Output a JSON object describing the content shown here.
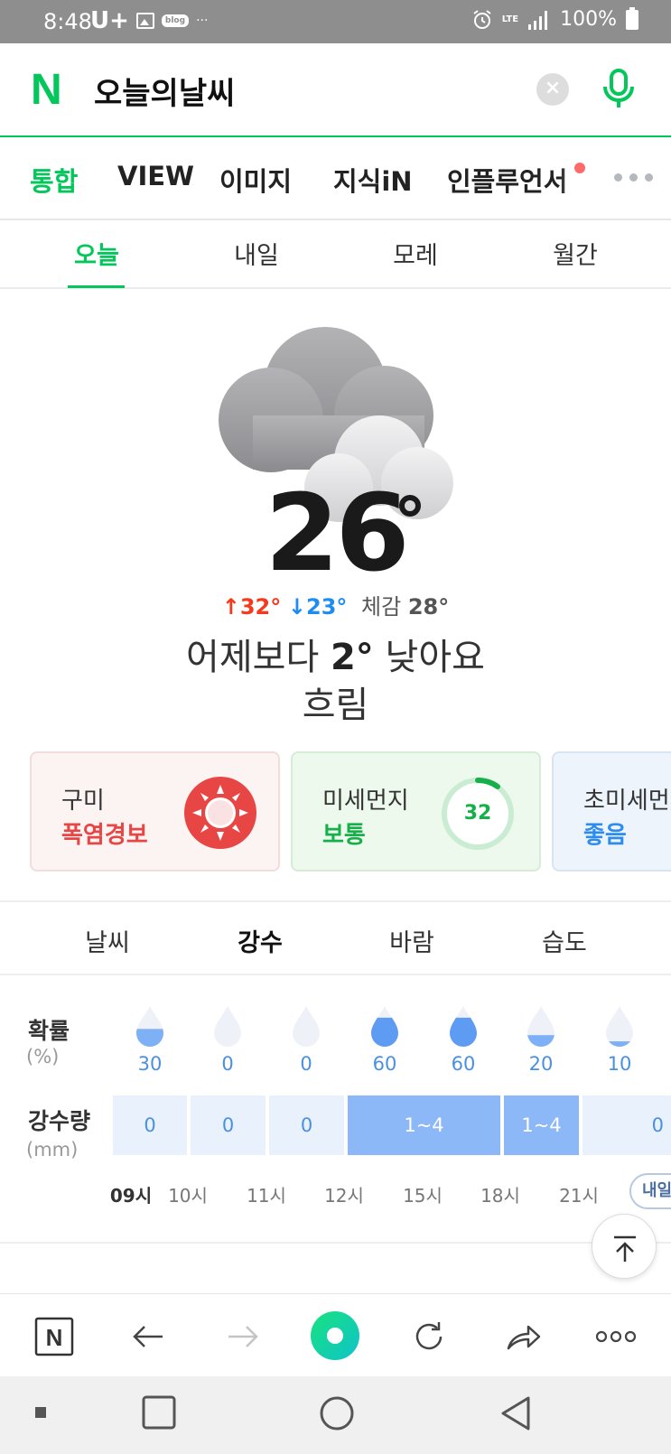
{
  "status_bar": {
    "time": "8:48",
    "carrier": "U+",
    "blog_badge": "blog",
    "overflow": "···",
    "lte": "LTE",
    "battery": "100%",
    "icons": [
      "image-icon",
      "blog-icon",
      "alarm-icon",
      "lte-icon",
      "signal-icon",
      "battery-icon"
    ]
  },
  "search": {
    "logo": "N",
    "query": "오늘의날씨",
    "clear_symbol": "×"
  },
  "category_tabs": [
    "통합",
    "VIEW",
    "이미지",
    "지식iN",
    "인플루언서"
  ],
  "day_tabs": [
    "오늘",
    "내일",
    "모레",
    "월간"
  ],
  "weather": {
    "temperature": "26",
    "high_arrow": "↑",
    "high": "32°",
    "low_arrow": "↓",
    "low": "23°",
    "feels_label": "체감",
    "feels": "28°",
    "compare_prefix": "어제보다",
    "compare_value": "2°",
    "compare_suffix": "낮아요",
    "condition": "흐림"
  },
  "cards": [
    {
      "title": "구미",
      "status": "폭염경보"
    },
    {
      "title": "미세먼지",
      "status": "보통",
      "value": "32"
    },
    {
      "title": "초미세먼",
      "status": "좋음"
    }
  ],
  "sub_tabs": [
    "날씨",
    "강수",
    "바람",
    "습도"
  ],
  "precip": {
    "prob_label": "확률",
    "prob_unit": "(%)",
    "amount_label": "강수량",
    "amount_unit": "(mm)",
    "probabilities": [
      "30",
      "0",
      "0",
      "60",
      "60",
      "20",
      "10"
    ],
    "amounts": [
      "0",
      "0",
      "0",
      "1~4",
      "1~4",
      "0"
    ],
    "times": [
      "09시",
      "10시",
      "11시",
      "12시",
      "15시",
      "18시",
      "21시"
    ],
    "tomorrow": "내일"
  },
  "colors": {
    "naver_green": "#03c75a",
    "high_temp": "#f53a1c",
    "low_temp": "#1f8cf2",
    "rain_blue": "#8db8f7"
  }
}
